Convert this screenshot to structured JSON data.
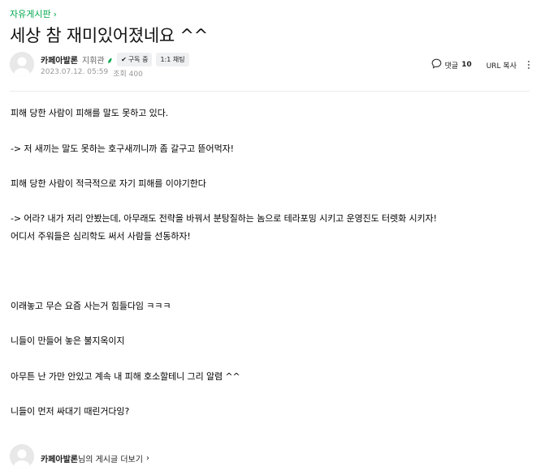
{
  "board": {
    "name": "자유게시판",
    "chevron_icon": "chevron-right-icon"
  },
  "post": {
    "title": "세상 참 재미있어졌네요 ^^",
    "author": {
      "name": "카페아발론",
      "grade": "지휘관",
      "grade_icon": "sprout-icon",
      "subscribe_label": "구독 중",
      "chat_label": "1:1 채팅"
    },
    "date": "2023.07.12. 05:59",
    "views": "조회 400",
    "tools": {
      "comment_icon": "speech-bubble-icon",
      "comment_label": "댓글",
      "comment_count": "10",
      "url_copy_label": "URL 복사",
      "more_icon": "more-vertical-icon"
    },
    "body": [
      "피해 당한 사람이 피해를 말도 못하고 있다.",
      "-> 저 새끼는 말도 못하는 호구새끼니까 좀 갈구고 뜯어먹자!",
      "피해 당한 사람이 적극적으로 자기 피해를 이야기한다",
      "-> 어라? 내가 저리 안봤는데, 아무래도 전략을 바꿔서 분탕질하는 놈으로 테라포밍 시키고 운영진도 터렛화 시키자!",
      "어디서 주워들은 심리학도 써서 사람들 선동하자!",
      "이래놓고 무슨 요즘 사는거 힘들다임 ㅋㅋㅋ",
      "니들이 만들어 놓은 불지옥이지",
      "아무튼 난 가만 안있고 계속 내 피해 호소할테니 그리 알렴 ^^",
      "니들이 먼저 싸대기 때린거다잉?"
    ],
    "footer": {
      "author_name": "카페아발론",
      "suffix": "님의 게시글 더보기"
    }
  },
  "colors": {
    "accent": "#03a94d",
    "meta": "#979797",
    "chip_bg": "#eff0f2",
    "divider": "#ebebeb"
  }
}
